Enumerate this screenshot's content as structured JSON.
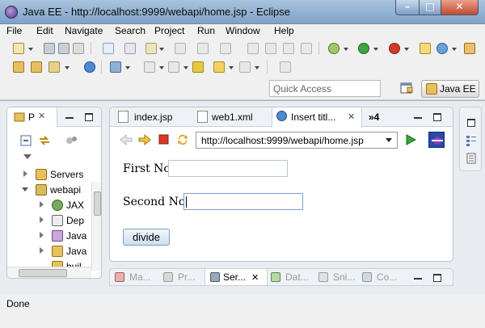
{
  "window": {
    "title": "Java EE - http://localhost:9999/webapi/home.jsp - Eclipse",
    "minimize": "–",
    "maximize": "□",
    "close": "✕"
  },
  "menu": [
    "File",
    "Edit",
    "Navigate",
    "Search",
    "Project",
    "Run",
    "Window",
    "Help"
  ],
  "quick_access": {
    "placeholder": "Quick Access"
  },
  "perspective": {
    "label": "Java EE"
  },
  "package_explorer": {
    "tab_label": "P",
    "tree": [
      {
        "label": "Servers",
        "expanded": false
      },
      {
        "label": "webapi",
        "expanded": true
      },
      {
        "label": "JAX",
        "expanded": false
      },
      {
        "label": "Dep",
        "expanded": false
      },
      {
        "label": "Java",
        "expanded": false
      },
      {
        "label": "Java",
        "expanded": false
      },
      {
        "label": "buil",
        "expanded": false
      }
    ]
  },
  "editor": {
    "tabs": [
      {
        "label": "index.jsp",
        "active": false
      },
      {
        "label": "web1.xml",
        "active": false
      },
      {
        "label": "Insert titl...",
        "active": true
      },
      {
        "label": "»4",
        "active": false
      }
    ],
    "browser": {
      "url": "http://localhost:9999/webapi/home.jsp"
    },
    "form": {
      "first_label": "First No:",
      "first_value": "",
      "second_label": "Second No:",
      "second_value": "",
      "button_label": "divide"
    }
  },
  "bottom_views": [
    {
      "label": "Ma...",
      "active": false
    },
    {
      "label": "Pr...",
      "active": false
    },
    {
      "label": "Ser...",
      "active": true
    },
    {
      "label": "Dat...",
      "active": false
    },
    {
      "label": "Sni...",
      "active": false
    },
    {
      "label": "Co...",
      "active": false
    }
  ],
  "status": {
    "text": "Done"
  }
}
